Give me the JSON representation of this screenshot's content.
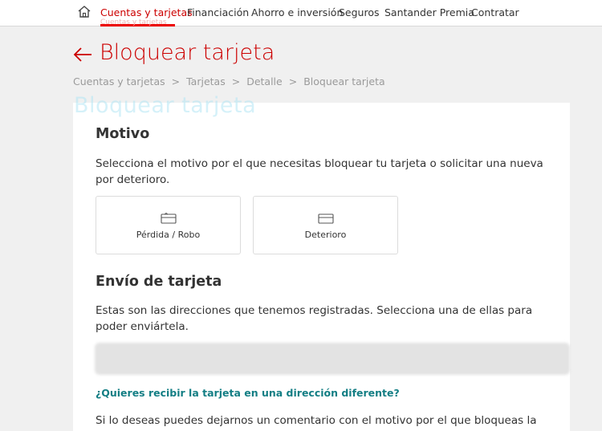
{
  "nav": {
    "home_icon": "home-icon",
    "items": [
      "Cuentas y tarjetas",
      "Financiación",
      "Ahorro e inversión",
      "Seguros",
      "Santander Premia",
      "Contratar"
    ],
    "active_index": 0,
    "accent": "#ec0000"
  },
  "header": {
    "back_icon": "arrow-left-icon",
    "title": "Bloquear tarjeta"
  },
  "breadcrumb": {
    "items": [
      "Cuentas y tarjetas",
      "Tarjetas",
      "Detalle",
      "Bloquear tarjeta"
    ],
    "separator": ">"
  },
  "motivo": {
    "title": "Motivo",
    "description": "Selecciona el motivo por el que necesitas bloquear tu tarjeta o solicitar una nueva por deterioro.",
    "options": [
      {
        "label": "Pérdida / Robo",
        "icon": "card-lost-icon"
      },
      {
        "label": "Deterioro",
        "icon": "card-damaged-icon"
      }
    ]
  },
  "envio": {
    "title": "Envío de tarjeta",
    "description": "Estas son las direcciones que tenemos registradas. Selecciona una de ellas para poder enviártela.",
    "alt_address_link": "¿Quieres recibir la tarjeta en una dirección diferente?",
    "comment_text": "Si lo deseas puedes dejarnos un comentario con el motivo por el que bloqueas la tarjeta."
  },
  "colors": {
    "brand_red": "#cc0000",
    "link_teal": "#137e84"
  }
}
